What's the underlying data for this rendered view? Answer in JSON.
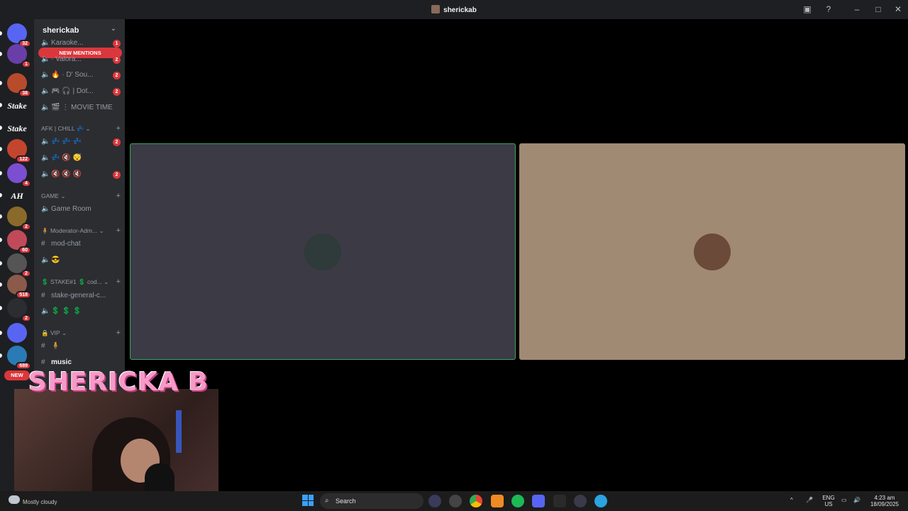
{
  "window": {
    "title": "sherickab"
  },
  "guilds": {
    "items": [
      {
        "name": "discord-home",
        "badge": "32",
        "color": "#5865f2"
      },
      {
        "name": "server-1",
        "badge": "1",
        "color": "#6a3ea8"
      },
      {
        "name": "server-2",
        "badge": "38",
        "color": "#b84b2c"
      },
      {
        "name": "stake-1",
        "text": "Stake",
        "badge": ""
      },
      {
        "name": "stake-2",
        "text": "Stake",
        "badge": ""
      },
      {
        "name": "server-6",
        "badge": "122",
        "color": "#c4452d"
      },
      {
        "name": "server-7",
        "badge": "4",
        "color": "#7b4fd0"
      },
      {
        "name": "server-ah",
        "text": "AH",
        "badge": ""
      },
      {
        "name": "server-9",
        "badge": "2",
        "color": "#8a6a2a"
      },
      {
        "name": "server-10",
        "badge": "60",
        "color": "#c04a5a"
      },
      {
        "name": "server-11",
        "badge": "2",
        "color": "#555555"
      },
      {
        "name": "server-12",
        "badge": "518",
        "color": "#8b5a4a"
      },
      {
        "name": "server-13",
        "badge": "2",
        "color": "#2b2d31"
      },
      {
        "name": "folder",
        "badge": "",
        "color": "#5865f2"
      },
      {
        "name": "server-15",
        "badge": "689",
        "color": "#2a7bb5"
      }
    ]
  },
  "server": {
    "name": "sherickab",
    "new_mentions": "NEW MENTIONS",
    "channels_top": [
      {
        "label": "Karaoke...",
        "badge": "1"
      },
      {
        "label": "· Valora...",
        "badge": "2"
      },
      {
        "label": "🔥 · D' Sou...",
        "badge": "2"
      },
      {
        "label": "🎮 🎧 | Dot...",
        "badge": "2"
      },
      {
        "label": "🎬 ⋮ MOVIE TIME",
        "badge": ""
      }
    ],
    "categories": [
      {
        "label": "AFK | CHILL 💤 ⌄",
        "channels": [
          {
            "label": "💤 💤 💤",
            "badge": "2",
            "icon": "voice"
          },
          {
            "label": "💤 🔇 😴",
            "badge": "",
            "icon": "voice"
          },
          {
            "label": "🔇 🔇 🔇",
            "badge": "2",
            "icon": "voice"
          }
        ]
      },
      {
        "label": "GAME ⌄",
        "channels": [
          {
            "label": "Game Room",
            "badge": "",
            "icon": "voice"
          }
        ]
      },
      {
        "label": "🧍 Moderator-Adm... ⌄",
        "channels": [
          {
            "label": "mod-chat",
            "badge": "",
            "icon": "text"
          },
          {
            "label": "😎",
            "badge": "",
            "icon": "voice"
          }
        ]
      },
      {
        "label": "💲 STAKE#1 💲 cod... ⌄",
        "channels": [
          {
            "label": "stake-general-c...",
            "badge": "",
            "icon": "text"
          },
          {
            "label": "💲 💲 💲",
            "badge": "",
            "icon": "voice"
          }
        ]
      },
      {
        "label": "🔒 VIP ⌄",
        "channels": [
          {
            "label": "🧍",
            "badge": "",
            "icon": "text"
          },
          {
            "label": "music",
            "badge": "",
            "icon": "text"
          }
        ]
      }
    ]
  },
  "call": {
    "participants": [
      {
        "name": "participant-1",
        "tile_color": "#3b3a45",
        "speaking": true,
        "avatar_color": "#2f3a3a"
      },
      {
        "name": "participant-2",
        "tile_color": "#a08a73",
        "speaking": false,
        "avatar_color": "#6b4a3a"
      }
    ]
  },
  "stream_overlay": {
    "name": "SHERICKA B",
    "new_label": "NEW"
  },
  "taskbar": {
    "weather": "Mostly cloudy",
    "search_placeholder": "Search",
    "language": "ENG",
    "region": "US",
    "time": "4:23 am",
    "date": "18/09/2025"
  }
}
